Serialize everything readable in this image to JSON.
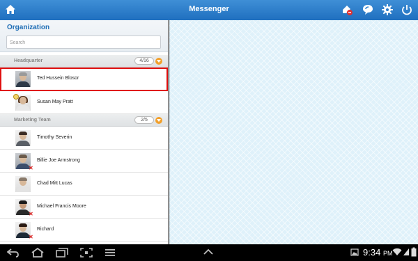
{
  "appbar": {
    "title": "Messenger",
    "actions": [
      "new-message-icon",
      "chat-icon",
      "settings-icon",
      "power-icon"
    ]
  },
  "organization": {
    "title": "Organization",
    "search_placeholder": "Search",
    "groups": [
      {
        "name": "Headquarter",
        "count": "4/16",
        "members": [
          {
            "name": "Ted Hussein Blosor",
            "selected": true
          },
          {
            "name": "Susan May Pratt",
            "status": "available"
          }
        ]
      },
      {
        "name": "Marketing Team",
        "count": "2/5",
        "members": [
          {
            "name": "Timothy Severin"
          },
          {
            "name": "Billie Joe Armstrong",
            "status": "offline"
          },
          {
            "name": "Chad Mitt Lucas"
          },
          {
            "name": "Michael Francis Moore",
            "status": "offline"
          },
          {
            "name": "Richard",
            "status": "offline"
          }
        ]
      }
    ]
  },
  "system_bar": {
    "time": "9:34",
    "ampm": "PM"
  },
  "colors": {
    "appbar": "#2a7dcc",
    "accent": "#1e6db5",
    "selection": "#e01010",
    "toggle": "#f2a02c"
  }
}
